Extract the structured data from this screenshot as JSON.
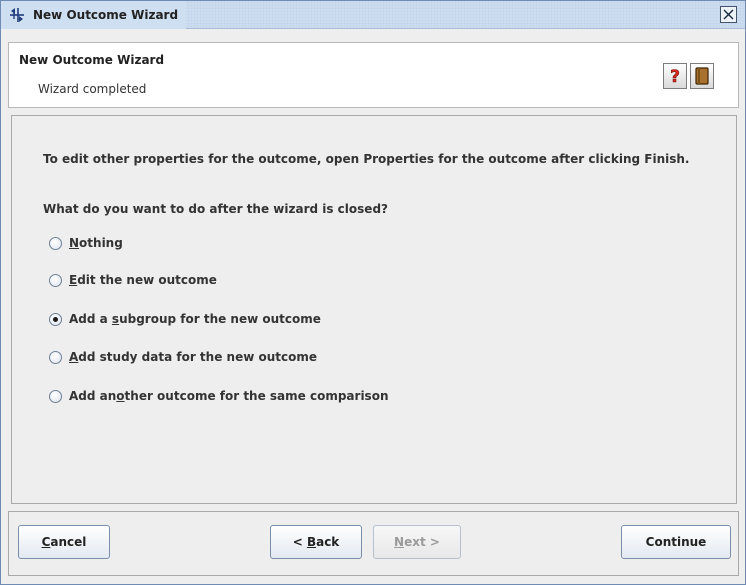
{
  "window": {
    "title": "New Outcome Wizard"
  },
  "header": {
    "title": "New Outcome Wizard",
    "subtitle": "Wizard completed",
    "help_icon": "help-question-icon",
    "book_icon": "book-icon"
  },
  "content": {
    "instruction": "To edit other properties for the outcome, open Properties for the outcome after clicking Finish.",
    "question": "What do you want to do after the wizard is closed?",
    "options": [
      {
        "pre": "",
        "mnemonic": "N",
        "post": "othing",
        "selected": false
      },
      {
        "pre": "",
        "mnemonic": "E",
        "post": "dit the new outcome",
        "selected": false
      },
      {
        "pre": "Add a ",
        "mnemonic": "s",
        "post": "ubgroup for the new outcome",
        "selected": true
      },
      {
        "pre": "",
        "mnemonic": "A",
        "post": "dd study data for the new outcome",
        "selected": false
      },
      {
        "pre": "Add an",
        "mnemonic": "o",
        "post": "ther outcome for the same comparison",
        "selected": false
      }
    ]
  },
  "buttons": {
    "cancel": {
      "mnemonic": "C",
      "rest": "ancel"
    },
    "back": {
      "pre": "< ",
      "mnemonic": "B",
      "rest": "ack"
    },
    "next": {
      "mnemonic": "N",
      "rest": "ext >",
      "enabled": false
    },
    "continue": "Continue"
  },
  "colors": {
    "titlebar": "#cfdff2",
    "window_bg": "#eeeeee",
    "help_red": "#d42a1f",
    "book_brown": "#8a5a22"
  }
}
